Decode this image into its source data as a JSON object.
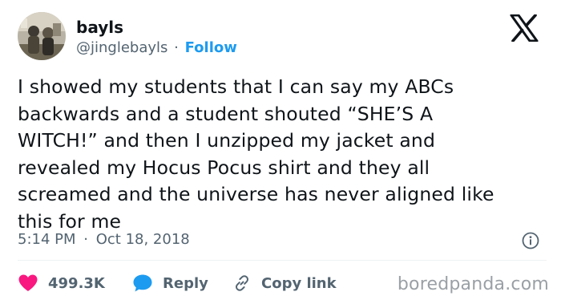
{
  "author": {
    "display_name": "bayls",
    "handle": "@jinglebayls",
    "separator": "·",
    "follow_label": "Follow"
  },
  "tweet": {
    "lines": [
      "I showed my students that I can say my ABCs",
      "backwards and a student shouted “SHE’S A",
      "WITCH!” and then I unzipped my jacket and",
      "revealed my Hocus Pocus shirt and they all",
      "screamed and the universe has never aligned like",
      "this for me"
    ],
    "time": "5:14 PM",
    "separator": "·",
    "date": "Oct 18, 2018"
  },
  "actions": {
    "likes": "499.3K",
    "reply_label": "Reply",
    "copy_link_label": "Copy link"
  },
  "watermark": "boredpanda.com",
  "icons": {
    "logo": "x-logo-icon",
    "info": "info-icon",
    "like": "heart-icon",
    "reply": "speech-bubble-icon",
    "copy": "link-icon"
  },
  "colors": {
    "text": "#0f1419",
    "secondary": "#536471",
    "link_blue": "#1d9bf0",
    "heart": "#f91880",
    "divider": "#eff3f4",
    "watermark": "#9aa0a6"
  }
}
